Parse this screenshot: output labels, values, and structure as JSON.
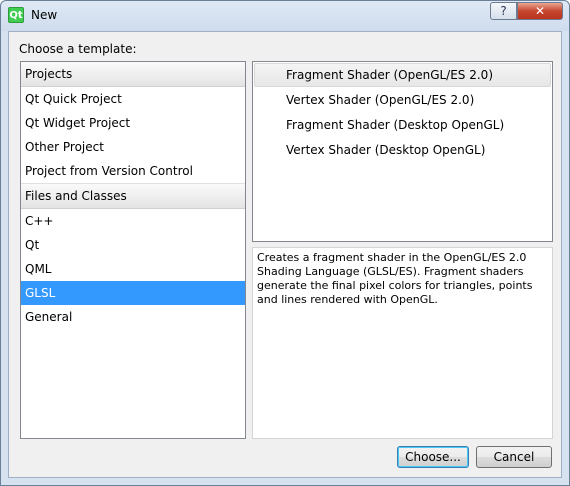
{
  "window": {
    "title": "New",
    "app_icon": "Qt",
    "help_label": "?",
    "close_label": "✕"
  },
  "prompt": "Choose a template:",
  "categories": {
    "projects_header": "Projects",
    "projects": [
      "Qt Quick Project",
      "Qt Widget Project",
      "Other Project",
      "Project from Version Control"
    ],
    "files_header": "Files and Classes",
    "files": [
      "C++",
      "Qt",
      "QML",
      "GLSL",
      "General"
    ],
    "selected": "GLSL"
  },
  "templates": {
    "items": [
      "Fragment Shader (OpenGL/ES 2.0)",
      "Vertex Shader (OpenGL/ES 2.0)",
      "Fragment Shader (Desktop OpenGL)",
      "Vertex Shader (Desktop OpenGL)"
    ],
    "selected": "Fragment Shader (OpenGL/ES 2.0)"
  },
  "description": "Creates a fragment shader in the OpenGL/ES 2.0 Shading Language (GLSL/ES). Fragment shaders generate the final pixel colors for triangles, points and lines rendered with OpenGL.",
  "buttons": {
    "choose": "Choose...",
    "cancel": "Cancel"
  }
}
